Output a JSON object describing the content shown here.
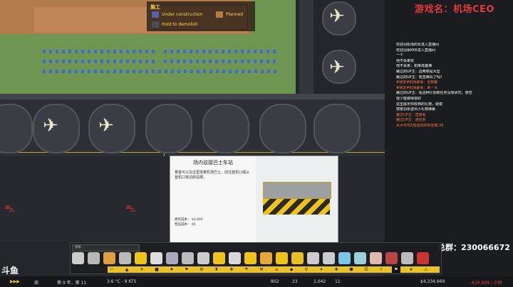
{
  "legend": {
    "title": "施工",
    "items": [
      {
        "label": "Under construction",
        "color": "#5c5fa8"
      },
      {
        "label": "Planned",
        "color": "#b57b47"
      },
      {
        "label": "Hold to demolish",
        "color": "#4a4e58"
      }
    ]
  },
  "streamer": {
    "name": "游戏名：机场CEO"
  },
  "group": {
    "text": "总群：230066672"
  },
  "dialog": {
    "title": "场内驳接巴士车站",
    "description": "乘客可以在这里搭乘机场巴士，前往登机口或从登机口抵达航站楼。",
    "stats": [
      {
        "label": "建筑成本：",
        "value": "$3,000"
      },
      {
        "label": "营运成本：",
        "value": "$5"
      }
    ]
  },
  "chat": [
    {
      "text": "欢迎羽机场的长进入直播间",
      "color": "#ffffff"
    },
    {
      "text": "欢迎羽余KKK进入直播间",
      "color": "#ffffff"
    },
    {
      "text": "一个",
      "color": "#ffffff"
    },
    {
      "text": "他不会来玩",
      "color": "#ffffff"
    },
    {
      "text": "他不会来：如果再塞满",
      "color": "#ffffff"
    },
    {
      "text": "路过的UP主：这两架是大型",
      "color": "#ffffff"
    },
    {
      "text": "路过的UP主：有直降机了吗?",
      "color": "#ffffff"
    },
    {
      "text": "#我爱#机场破事：全部都",
      "color": "#ff7a3a"
    },
    {
      "text": "#我爱#机场破事：来一大",
      "color": "#ff7a3a"
    },
    {
      "text": "路过的UP主：看这种计划和任务没有研究，感觉",
      "color": "#ffffff"
    },
    {
      "text": "很少能做得很好",
      "color": "#ffffff"
    },
    {
      "text": "这里展示你收到的礼物，谢谢",
      "color": "#ffffff"
    },
    {
      "text": "感谢羽余送出小礼物弹幕",
      "color": "#ffffff"
    },
    {
      "text": "路过UP主：直接看",
      "color": "#ff7a3a"
    },
    {
      "text": "路过UP主：连任务",
      "color": "#ff7a3a"
    },
    {
      "text": "水木可可Z加送出的热爱榜 26",
      "color": "#ff7a3a"
    }
  ],
  "toolbar": {
    "search_placeholder": "搜索",
    "categories": [
      "⚐",
      "▲",
      "✈",
      "■",
      "♦",
      "⚑",
      "⚙",
      "♜",
      "❖",
      "☂",
      "⚒",
      "⌂",
      "◆",
      "⚲",
      "✦",
      "✚",
      "⬢",
      "☰",
      "⚡",
      "⚑",
      "★",
      "⚠"
    ],
    "selected_category": 19
  },
  "statusbar": {
    "day": "周",
    "date_label": "第 9 年，第 11",
    "weather": "3.6 °C - 9 KTS",
    "stat1": "802",
    "stat2": "23",
    "stat3": "1,042",
    "stat4": "11",
    "money": "$4,334,669",
    "income": "-$10,929 / 小时"
  },
  "logo_text": "斗鱼",
  "colors": {
    "grass": "#6f9650",
    "construction": "#b47a4a",
    "toolbar_accent": "#e9c12a",
    "streamer_red": "#e23a3a"
  }
}
